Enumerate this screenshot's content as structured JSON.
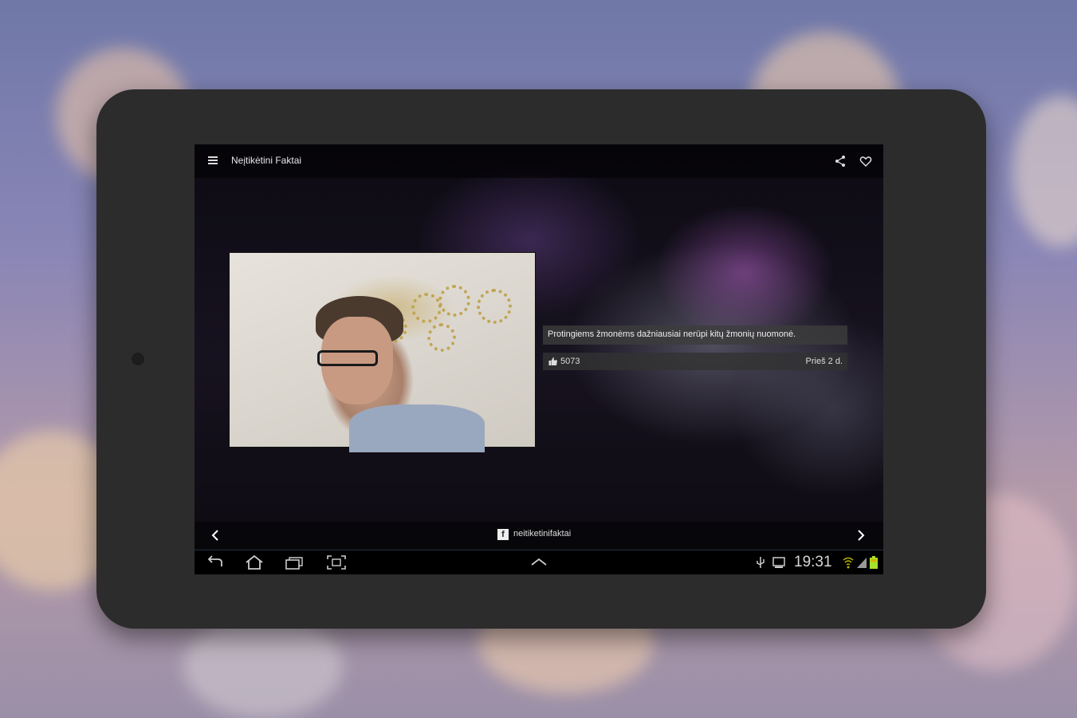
{
  "app": {
    "title": "Neįtikėtini Faktai"
  },
  "fact": {
    "text": "Protingiems žmonėms dažniausiai nerūpi kitų žmonių nuomonė.",
    "likes": "5073",
    "date": "Prieš 2 d."
  },
  "footer": {
    "facebook_page": "neitiketinifaktai",
    "facebook_glyph": "f"
  },
  "status_bar": {
    "time": "19:31"
  },
  "colors": {
    "battery": "#a6e22e",
    "accent_line": "#1e2a3a"
  }
}
